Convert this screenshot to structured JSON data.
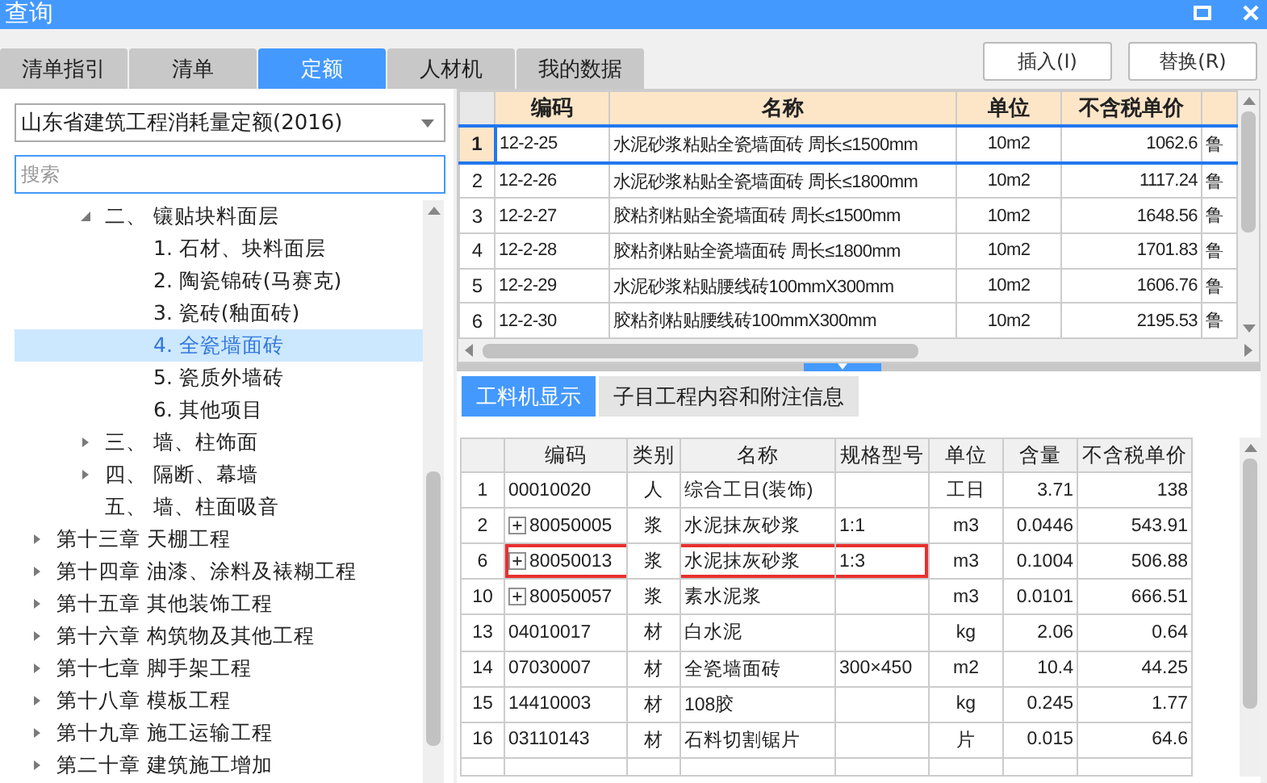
{
  "window": {
    "title": "查询"
  },
  "tabs": [
    {
      "label": "清单指引",
      "selected": false
    },
    {
      "label": "清单",
      "selected": false
    },
    {
      "label": "定额",
      "selected": true
    },
    {
      "label": "人材机",
      "selected": false
    },
    {
      "label": "我的数据",
      "selected": false
    }
  ],
  "buttons": [
    "插入(I)",
    "替换(R)"
  ],
  "library_select": {
    "value": "山东省建筑工程消耗量定额(2016)"
  },
  "search": {
    "placeholder": "搜索"
  },
  "tree": {
    "upper_branch": [
      {
        "label": "二、 镶贴块料面层",
        "expanded": true,
        "selected": false,
        "children": [
          {
            "label": "1. 石材、块料面层",
            "selected": false
          },
          {
            "label": "2. 陶瓷锦砖(马赛克)",
            "selected": false
          },
          {
            "label": "3. 瓷砖(釉面砖)",
            "selected": false
          },
          {
            "label": "4. 全瓷墙面砖",
            "selected": true
          },
          {
            "label": "5. 瓷质外墙砖",
            "selected": false
          },
          {
            "label": "6. 其他项目",
            "selected": false
          }
        ]
      },
      {
        "label": "三、 墙、柱饰面",
        "expanded": false,
        "selected": false
      },
      {
        "label": "四、 隔断、幕墙",
        "expanded": false,
        "selected": false
      },
      {
        "label": "五、 墙、柱面吸音",
        "selected": false
      }
    ],
    "chapters": [
      {
        "label": "第十三章 天棚工程",
        "expanded": false,
        "selected": false
      },
      {
        "label": "第十四章 油漆、涂料及裱糊工程",
        "expanded": false,
        "selected": false
      },
      {
        "label": "第十五章 其他装饰工程",
        "expanded": false,
        "selected": false
      },
      {
        "label": "第十六章 构筑物及其他工程",
        "expanded": false,
        "selected": false
      },
      {
        "label": "第十七章 脚手架工程",
        "expanded": false,
        "selected": false
      },
      {
        "label": "第十八章 模板工程",
        "expanded": false,
        "selected": false
      },
      {
        "label": "第十九章 施工运输工程",
        "expanded": false,
        "selected": false
      },
      {
        "label": "第二十章 建筑施工增加",
        "expanded": false,
        "selected": false
      }
    ]
  },
  "quota_table": {
    "columns": [
      "编码",
      "名称",
      "单位",
      "不含税单价"
    ],
    "rows": [
      {
        "no": "1",
        "code": "12-2-25",
        "name": "水泥砂浆粘贴全瓷墙面砖 周长≤1500mm",
        "unit": "10m2",
        "price": "1062.6",
        "column_5": "鲁",
        "selected": true
      },
      {
        "no": "2",
        "code": "12-2-26",
        "name": "水泥砂浆粘贴全瓷墙面砖 周长≤1800mm",
        "unit": "10m2",
        "price": "1117.24",
        "column_5": "鲁",
        "selected": false
      },
      {
        "no": "3",
        "code": "12-2-27",
        "name": "胶粘剂粘贴全瓷墙面砖 周长≤1500mm",
        "unit": "10m2",
        "price": "1648.56",
        "column_5": "鲁",
        "selected": false
      },
      {
        "no": "4",
        "code": "12-2-28",
        "name": "胶粘剂粘贴全瓷墙面砖 周长≤1800mm",
        "unit": "10m2",
        "price": "1701.83",
        "column_5": "鲁",
        "selected": false
      },
      {
        "no": "5",
        "code": "12-2-29",
        "name": "水泥砂浆粘贴腰线砖100mmX300mm",
        "unit": "10m2",
        "price": "1606.76",
        "column_5": "鲁",
        "selected": false
      },
      {
        "no": "6",
        "code": "12-2-30",
        "name": "胶粘剂粘贴腰线砖100mmX300mm",
        "unit": "10m2",
        "price": "2195.53",
        "column_5": "鲁",
        "selected": false
      }
    ]
  },
  "detail_tabs": [
    {
      "label": "工料机显示",
      "selected": true
    },
    {
      "label": "子目工程内容和附注信息",
      "selected": false
    }
  ],
  "resource_table": {
    "columns": [
      "编码",
      "类别",
      "名称",
      "规格型号",
      "单位",
      "含量",
      "不含税单价"
    ],
    "rows": [
      {
        "no": "1",
        "code": "00010020",
        "type": "人",
        "name": "综合工日(装饰)",
        "spec": "",
        "unit": "工日",
        "amount": "3.71",
        "price": "138",
        "expandable": false,
        "highlighted": false
      },
      {
        "no": "2",
        "code": "80050005",
        "type": "浆",
        "name": "水泥抹灰砂浆",
        "spec": "1:1",
        "unit": "m3",
        "amount": "0.0446",
        "price": "543.91",
        "expandable": true,
        "highlighted": false
      },
      {
        "no": "6",
        "code": "80050013",
        "type": "浆",
        "name": "水泥抹灰砂浆",
        "spec": "1:3",
        "unit": "m3",
        "amount": "0.1004",
        "price": "506.88",
        "expandable": true,
        "highlighted": true
      },
      {
        "no": "10",
        "code": "80050057",
        "type": "浆",
        "name": "素水泥浆",
        "spec": "",
        "unit": "m3",
        "amount": "0.0101",
        "price": "666.51",
        "expandable": true,
        "highlighted": false
      },
      {
        "no": "13",
        "code": "04010017",
        "type": "材",
        "name": "白水泥",
        "spec": "",
        "unit": "kg",
        "amount": "2.06",
        "price": "0.64",
        "expandable": false,
        "highlighted": false
      },
      {
        "no": "14",
        "code": "07030007",
        "type": "材",
        "name": "全瓷墙面砖",
        "spec": "300×450",
        "unit": "m2",
        "amount": "10.4",
        "price": "44.25",
        "expandable": false,
        "highlighted": false
      },
      {
        "no": "15",
        "code": "14410003",
        "type": "材",
        "name": "108胶",
        "spec": "",
        "unit": "kg",
        "amount": "0.245",
        "price": "1.77",
        "expandable": false,
        "highlighted": false
      },
      {
        "no": "16",
        "code": "03110143",
        "type": "材",
        "name": "石料切割锯片",
        "spec": "",
        "unit": "片",
        "amount": "0.015",
        "price": "64.6",
        "expandable": false,
        "highlighted": false
      }
    ]
  }
}
